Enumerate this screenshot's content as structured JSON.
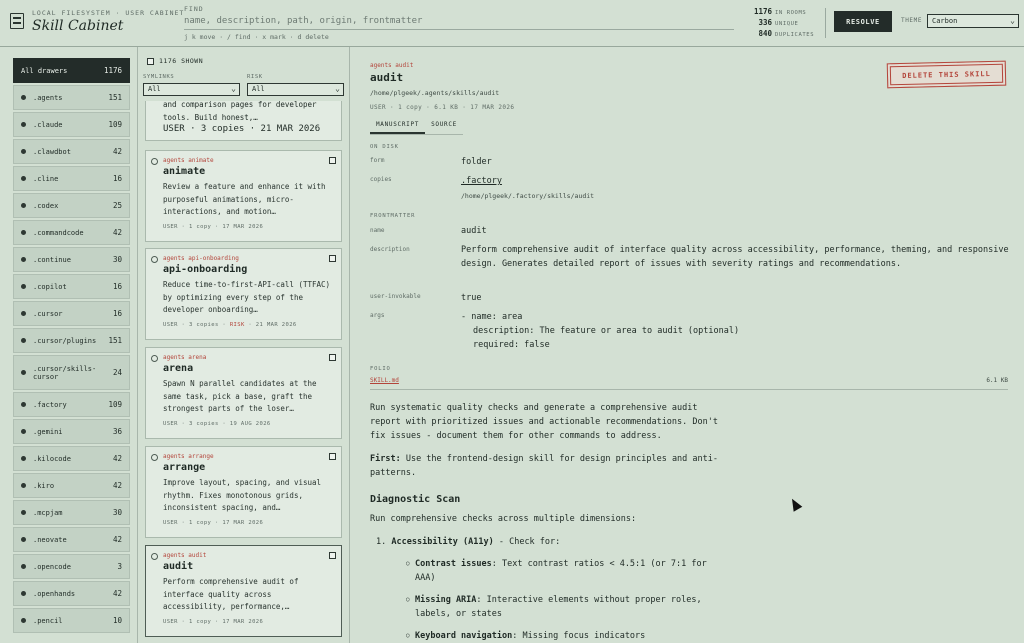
{
  "header": {
    "eyebrow": "LOCAL FILESYSTEM · USER CABINET",
    "title": "Skill Cabinet",
    "find_label": "FIND",
    "find_placeholder": "name, description, path, origin, frontmatter",
    "find_hints": "j k move · / find · x mark · d delete",
    "stats": [
      {
        "num": "1176",
        "label": "IN ROOMS"
      },
      {
        "num": "336",
        "label": "UNIQUE"
      },
      {
        "num": "840",
        "label": "DUPLICATES"
      }
    ],
    "resolve_label": "RESOLVE",
    "theme_label": "THEME",
    "theme_value": "Carbon"
  },
  "sidebar": {
    "items": [
      {
        "label": "All drawers",
        "count": "1176",
        "active": true
      },
      {
        "label": ".agents",
        "count": "151"
      },
      {
        "label": ".claude",
        "count": "109"
      },
      {
        "label": ".clawdbot",
        "count": "42"
      },
      {
        "label": ".cline",
        "count": "16"
      },
      {
        "label": ".codex",
        "count": "25"
      },
      {
        "label": ".commandcode",
        "count": "42"
      },
      {
        "label": ".continue",
        "count": "30"
      },
      {
        "label": ".copilot",
        "count": "16"
      },
      {
        "label": ".cursor",
        "count": "16"
      },
      {
        "label": ".cursor/plugins",
        "count": "151"
      },
      {
        "label": ".cursor/skills-cursor",
        "count": "24"
      },
      {
        "label": ".factory",
        "count": "109"
      },
      {
        "label": ".gemini",
        "count": "36"
      },
      {
        "label": ".kilocode",
        "count": "42"
      },
      {
        "label": ".kiro",
        "count": "42"
      },
      {
        "label": ".mcpjam",
        "count": "30"
      },
      {
        "label": ".neovate",
        "count": "42"
      },
      {
        "label": ".opencode",
        "count": "3"
      },
      {
        "label": ".openhands",
        "count": "42"
      },
      {
        "label": ".pencil",
        "count": "10"
      }
    ]
  },
  "list": {
    "shown": "1176 SHOWN",
    "filter_symlinks_label": "SYMLINKS",
    "filter_symlinks_value": "All",
    "filter_risk_label": "RISK",
    "filter_risk_value": "All",
    "top_fragment": {
      "desc": "and comparison pages for developer tools. Build honest,…",
      "meta": "USER · 3 copies · 21 MAR 2026"
    },
    "cards": [
      {
        "tag": "agents animate",
        "name": "animate",
        "desc": "Review a feature and enhance it with purposeful animations, micro-interactions, and motion…",
        "meta": "USER · 1 copy · 17 MAR 2026",
        "risk": ""
      },
      {
        "tag": "agents api-onboarding",
        "name": "api-onboarding",
        "desc": "Reduce time-to-first-API-call (TTFAC) by optimizing every step of the developer onboarding…",
        "meta": "USER · 3 copies · ",
        "risk": "RISK",
        "meta2": " · 21 MAR 2026"
      },
      {
        "tag": "agents arena",
        "name": "arena",
        "desc": "Spawn N parallel candidates at the same task, pick a base, graft the strongest parts of the loser…",
        "meta": "USER · 3 copies · 19 AUG 2026",
        "risk": ""
      },
      {
        "tag": "agents arrange",
        "name": "arrange",
        "desc": "Improve layout, spacing, and visual rhythm. Fixes monotonous grids, inconsistent spacing, and…",
        "meta": "USER · 1 copy · 17 MAR 2026",
        "risk": ""
      },
      {
        "tag": "agents audit",
        "name": "audit",
        "desc": "Perform comprehensive audit of interface quality across accessibility, performance,…",
        "meta": "USER · 1 copy · 17 MAR 2026",
        "risk": "",
        "selected": true
      }
    ]
  },
  "detail": {
    "tag": "agents audit",
    "title": "audit",
    "path": "/home/plgeek/.agents/skills/audit",
    "meta": "USER · 1 copy · 6.1 KB · 17 MAR 2026",
    "tabs": [
      "MANUSCRIPT",
      "SOURCE"
    ],
    "delete_label": "DELETE THIS SKILL",
    "on_disk_label": "ON DISK",
    "form_key": "form",
    "form_val": "folder",
    "copies_key": "copies",
    "copies_link": ".factory",
    "copies_path": "/home/plgeek/.factory/skills/audit",
    "frontmatter_label": "FRONTMATTER",
    "fm": {
      "name_key": "name",
      "name_val": "audit",
      "desc_key": "description",
      "desc_val": "Perform comprehensive audit of interface quality across accessibility, performance, theming, and responsive design. Generates detailed report of issues with severity ratings and recommendations.",
      "ui_key": "user-invokable",
      "ui_val": "true",
      "args_key": "args",
      "args_l1": "- name: area",
      "args_l2": "description: The feature or area to audit (optional)",
      "args_l3": "required: false"
    },
    "folio_label": "FOLIO",
    "folio_file": "SKILL.md",
    "folio_size": "6.1 KB",
    "md": {
      "p1": "Run systematic quality checks and generate a comprehensive audit report with prioritized issues and actionable recommendations. Don't fix issues - document them for other commands to address.",
      "first_bold": "First:",
      "first_rest": " Use the frontend-design skill for design principles and anti-patterns.",
      "h_diag": "Diagnostic Scan",
      "diag_p": "Run comprehensive checks across multiple dimensions:",
      "li1_num": "1.",
      "li1_bold": "Accessibility (A11y)",
      "li1_rest": " - Check for:",
      "sub1_bold": "Contrast issues",
      "sub1_rest": ": Text contrast ratios < 4.5:1 (or 7:1 for AAA)",
      "sub2_bold": "Missing ARIA",
      "sub2_rest": ": Interactive elements without proper roles, labels, or states",
      "sub3_bold": "Keyboard navigation",
      "sub3_rest": ": Missing focus indicators"
    }
  }
}
